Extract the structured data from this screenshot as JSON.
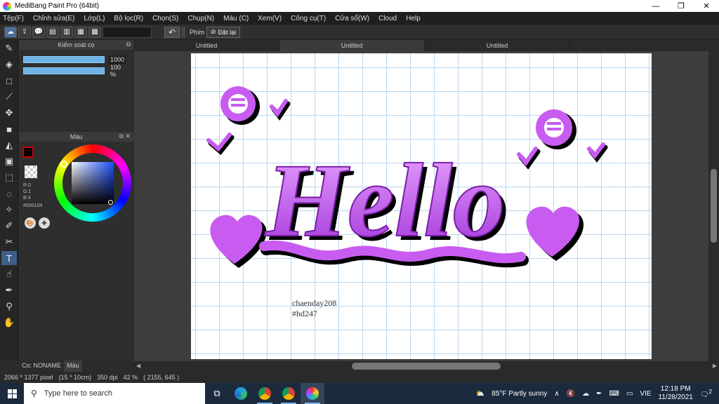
{
  "window": {
    "title": "MediBang Paint Pro (64bit)",
    "controls": [
      "—",
      "❐",
      "✕"
    ]
  },
  "menu": [
    "Tệp(F)",
    "Chỉnh sửa(E)",
    "Lớp(L)",
    "Bộ lọc(R)",
    "Chọn(S)",
    "Chụp(N)",
    "Màu (C)",
    "Xem(V)",
    "Công cụ(T)",
    "Cửa sổ(W)",
    "Cloud",
    "Help"
  ],
  "toolbar": {
    "buttons": [
      "cloud-icon",
      "upload-icon",
      "chat-icon",
      "comment-icon",
      "page-icon",
      "settings-page-icon",
      "grid-icon"
    ],
    "undo_icon": "undo-icon",
    "key_label": "Phím",
    "reset_label": "Đặt lại",
    "reset_icon": "no-symbol-icon"
  },
  "tools": [
    "brush-icon",
    "eraser-icon",
    "rectangle-icon",
    "pen-icon",
    "move-icon",
    "fill-rect-icon",
    "bucket-icon",
    "gradient-icon",
    "select-rect-icon",
    "lasso-icon",
    "magic-wand-icon",
    "select-pen-icon",
    "select-eraser-icon",
    "text-icon",
    "operation-icon",
    "dropper-icon",
    "dropper-2-icon",
    "hand-icon"
  ],
  "active_tool_index": 13,
  "brush_panel": {
    "title": "Kiểm soát cọ",
    "size_value": "1000",
    "size_fraction": 1.0,
    "opacity_value": "100 %",
    "opacity_fraction": 1.0
  },
  "color_panel": {
    "title": "Màu",
    "foreground": "#000000",
    "background": "#ffffff",
    "r": "R:0",
    "g": "G:1",
    "b": "B:4",
    "hex": "#000104"
  },
  "panel_tabs": [
    "Co: NONAME",
    "Màu"
  ],
  "tabs": [
    "Untitled",
    "Untitled",
    "Untitled"
  ],
  "active_tab": 1,
  "canvas": {
    "artwork_text": "Hello",
    "caption_line1": "chaenday208",
    "caption_line2": "#hd247",
    "accent": "#c04ee8"
  },
  "status": {
    "size": "2066 * 1377 pixel",
    "dims": "(15 * 10cm)",
    "dpi": "350 dpi",
    "zoom": "42 %",
    "coords": "( 2155, 645 )"
  },
  "taskbar": {
    "search_placeholder": "Type here to search",
    "apps": [
      "task-view-icon",
      "edge-icon",
      "chrome-icon",
      "chrome-icon-2",
      "medibang-icon"
    ],
    "weather": "85°F  Partly sunny",
    "lang": "VIE",
    "time": "12:18 PM",
    "date": "11/28/2021",
    "notif_count": "2"
  }
}
